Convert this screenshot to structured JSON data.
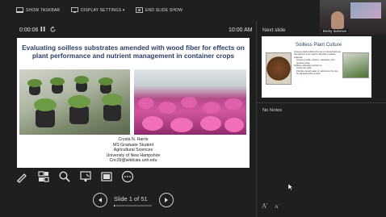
{
  "toolbar": {
    "show_taskbar": "SHOW TASKBAR",
    "display_settings": "DISPLAY SETTINGS ▾",
    "end_slide_show": "END SLIDE SHOW"
  },
  "timer": {
    "elapsed": "0:00:06",
    "clock": "10:00 AM"
  },
  "slide": {
    "title": "Evaluating soilless substrates amended with wood fiber for effects on plant performance and nutrient management in container crops",
    "author_lines": [
      "Crysta N. Harris",
      "MS Graduate Student",
      "Agricultural Sciences",
      "University of New Hampshire",
      "Cnc39@wildcats.unh.edu"
    ]
  },
  "navigation": {
    "slide_counter": "Slide 1 of 51",
    "progress": 0.0196
  },
  "next_slide": {
    "label": "Next slide",
    "title": "Soilless Plant Culture",
    "bullets": [
      "Growing plants without the use of mineral field soil",
      "Several terms are used to describe a soilless substrate",
      "Growing media, medium, substrates, and growing mixes",
      "Soilless substrates function to:",
      "Anchor the plant",
      "Provide enough water or nutrients to the root for adequate plant growth"
    ]
  },
  "notes": {
    "text": "No Notes"
  },
  "presenter": {
    "name": "Becky Sideman"
  },
  "font_controls": {
    "increase": "A",
    "decrease": "A"
  },
  "icons": [
    "taskbar-icon",
    "display-settings-icon",
    "end-show-icon",
    "pause-icon",
    "reset-icon",
    "pen-icon",
    "slides-grid-icon",
    "zoom-icon",
    "pointer-icon",
    "black-screen-icon",
    "more-icon",
    "prev-icon",
    "next-icon"
  ],
  "colors": {
    "background": "#1f1f1f",
    "title_blue": "#2c3e66"
  }
}
